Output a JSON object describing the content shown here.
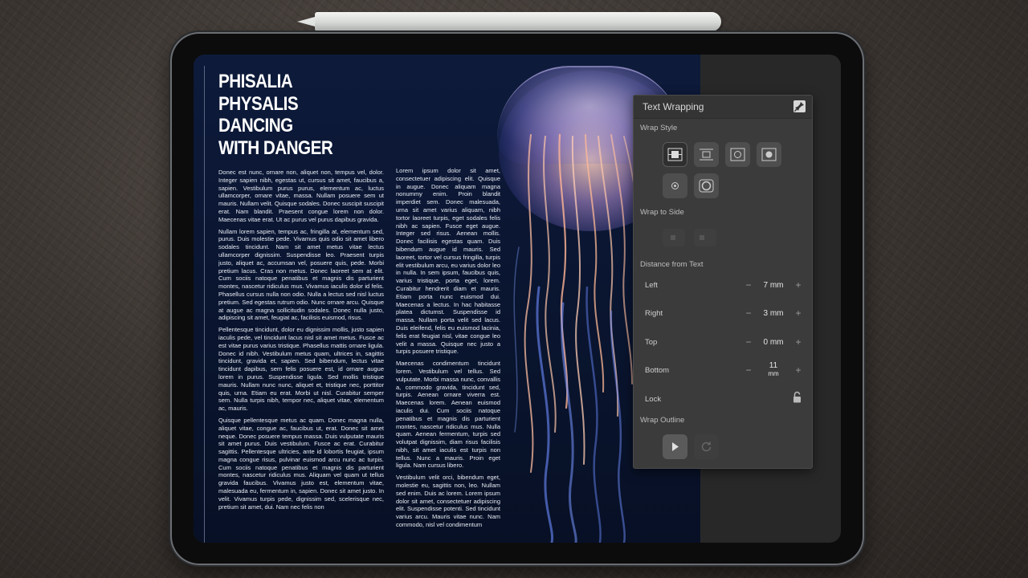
{
  "document": {
    "headline": "PHISALIA PHYSALIS DANCING WITH DANGER",
    "column1": [
      "Donec est nunc, ornare non, aliquet non, tempus vel, dolor. Integer sapien nibh, egestas ut, cursus sit amet, faucibus a, sapien. Vestibulum purus purus, elementum ac, luctus ullamcorper, ornare vitae, massa. Nullam posuere sem ut mauris. Nullam velit. Quisque sodales. Donec suscipit suscipit erat. Nam blandit. Praesent congue lorem non dolor. Maecenas vitae erat. Ut ac purus vel purus dapibus gravida.",
      "Nullam lorem sapien, tempus ac, fringilla at, elementum sed, purus. Duis molestie pede. Vivamus quis odio sit amet libero sodales tincidunt. Nam sit amet metus vitae lectus ullamcorper dignissim. Suspendisse leo. Praesent turpis justo, aliquet ac, accumsan vel, posuere quis, pede. Morbi pretium lacus. Cras non metus. Donec laoreet sem at elit. Cum sociis natoque penatibus et magnis dis parturient montes, nascetur ridiculus mus. Vivamus iaculis dolor id felis. Phasellus cursus nulla non odio. Nulla a lectus sed nisl luctus pretium. Sed egestas rutrum odio. Nunc ornare arcu. Quisque at augue ac magna sollicitudin sodales. Donec nulla justo, adipiscing sit amet, feugiat ac, facilisis euismod, risus.",
      "Pellentesque tincidunt, dolor eu dignissim mollis, justo sapien iaculis pede, vel tincidunt lacus nisl sit amet metus. Fusce ac est vitae purus varius tristique. Phasellus mattis ornare ligula. Donec id nibh. Vestibulum metus quam, ultrices in, sagittis tincidunt, gravida et, sapien. Sed bibendum, lectus vitae tincidunt dapibus, sem felis posuere est, id ornare augue lorem in purus. Suspendisse ligula. Sed mollis tristique mauris. Nullam nunc nunc, aliquet et, tristique nec, porttitor quis, urna. Etiam eu erat. Morbi ut nisl. Curabitur semper sem. Nulla turpis nibh, tempor nec, aliquet vitae, elementum ac, mauris.",
      "Quisque pellentesque metus ac quam. Donec magna nulla, aliquet vitae, congue ac, faucibus ut, erat. Donec sit amet neque. Donec posuere tempus massa. Duis vulputate mauris sit amet purus. Duis vestibulum. Fusce ac erat. Curabitur sagittis. Pellentesque ultricies, ante id lobortis feugiat, ipsum magna congue risus, pulvinar euismod arcu nunc ac turpis. Cum sociis natoque penatibus et magnis dis parturient montes, nascetur ridiculus mus. Aliquam vel quam ut tellus gravida faucibus. Vivamus justo est, elementum vitae, malesuada eu, fermentum in, sapien. Donec sit amet justo. In velit. Vivamus turpis pede, dignissim sed, scelerisque nec, pretium sit amet, dui. Nam nec felis non"
    ],
    "column2": [
      "Lorem ipsum dolor sit amet, consectetuer adipiscing elit. Quisque in augue. Donec aliquam magna nonummy enim. Proin blandit imperdiet sem. Donec malesuada, urna sit amet varius aliquam, nibh tortor laoreet turpis, eget sodales felis nibh ac sapien. Fusce eget augue. Integer sed risus. Aenean mollis. Donec facilisis egestas quam. Duis bibendum augue id mauris. Sed laoreet, tortor vel cursus fringilla, turpis elit vestibulum arcu, eu varius dolor leo in nulla. In sem ipsum, faucibus quis, varius tristique, porta eget, lorem. Curabitur hendrerit diam et mauris. Etiam porta nunc euismod dui. Maecenas a lectus. In hac habitasse platea dictumst. Suspendisse id massa. Nullam porta velit sed lacus. Duis eleifend, felis eu euismod lacinia, felis erat feugiat nisl, vitae congue leo velit a massa. Quisque nec justo a turpis posuere tristique.",
      "Maecenas condimentum tincidunt lorem. Vestibulum vel tellus. Sed vulputate. Morbi massa nunc, convallis a, commodo gravida, tincidunt sed, turpis. Aenean ornare viverra est. Maecenas lorem. Aenean euismod iaculis dui. Cum sociis natoque penatibus et magnis dis parturient montes, nascetur ridiculus mus. Nulla quam. Aenean fermentum, turpis sed volutpat dignissim, diam risus facilisis nibh, sit amet iaculis est turpis non tellus. Nunc a mauris. Proin eget ligula. Nam cursus libero.",
      "Vestibulum velit orci, bibendum eget, molestie eu, sagittis non, leo. Nullam sed enim. Duis ac lorem. Lorem ipsum dolor sit amet, consectetuer adipiscing elit. Suspendisse potenti. Sed tincidunt varius arcu. Mauris vitae nunc. Nam commodo, nisl vel condimentum"
    ]
  },
  "panel": {
    "title": "Text Wrapping",
    "wrap_style_label": "Wrap Style",
    "wrap_to_side_label": "Wrap to Side",
    "distance_label": "Distance from Text",
    "rows": [
      {
        "label": "Left",
        "value": "7 mm"
      },
      {
        "label": "Right",
        "value": "3 mm"
      },
      {
        "label": "Top",
        "value": "0 mm"
      },
      {
        "label": "Bottom",
        "value": "11",
        "unit": "mm"
      }
    ],
    "minus": "−",
    "plus": "+",
    "lock_label": "Lock",
    "wrap_outline_label": "Wrap Outline"
  }
}
